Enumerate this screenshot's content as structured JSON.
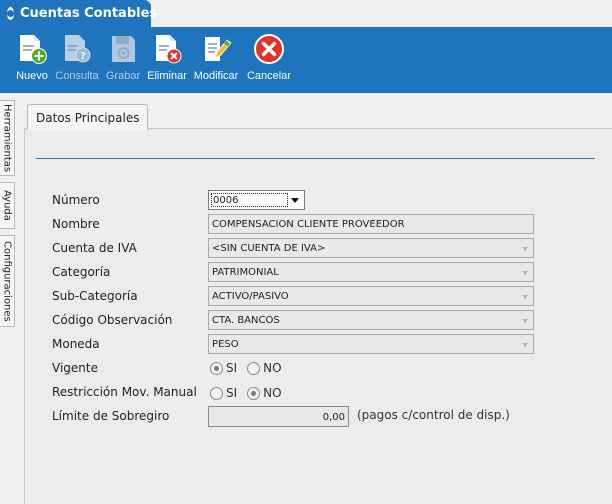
{
  "window": {
    "title": "Cuentas Contables"
  },
  "toolbar": {
    "buttons": [
      {
        "label": "Nuevo",
        "icon": "new-document-plus-icon",
        "enabled": true
      },
      {
        "label": "Consulta",
        "icon": "document-question-icon",
        "enabled": false
      },
      {
        "label": "Grabar",
        "icon": "save-disk-icon",
        "enabled": false
      },
      {
        "label": "Eliminar",
        "icon": "delete-document-icon",
        "enabled": true
      },
      {
        "label": "Modificar",
        "icon": "edit-pencil-icon",
        "enabled": true
      },
      {
        "label": "Cancelar",
        "icon": "cancel-x-icon",
        "enabled": true
      }
    ]
  },
  "side_tabs": [
    "Herramientas",
    "Ayuda",
    "Configuraciones"
  ],
  "panel": {
    "tab": "Datos Principales"
  },
  "form": {
    "numero": {
      "label": "Número",
      "value": "0006"
    },
    "nombre": {
      "label": "Nombre",
      "value": "COMPENSACION CLIENTE PROVEEDOR"
    },
    "cuenta_iva": {
      "label": "Cuenta de IVA",
      "value": "<SIN CUENTA DE IVA>"
    },
    "categoria": {
      "label": "Categoría",
      "value": "PATRIMONIAL"
    },
    "sub_categoria": {
      "label": "Sub-Categoría",
      "value": "ACTIVO/PASIVO"
    },
    "codigo_observacion": {
      "label": "Código Observación",
      "value": "CTA. BANCOS"
    },
    "moneda": {
      "label": "Moneda",
      "value": "PESO"
    },
    "vigente": {
      "label": "Vigente",
      "options": [
        "SI",
        "NO"
      ],
      "selected": "SI"
    },
    "restriccion": {
      "label": "Restricción Mov. Manual",
      "options": [
        "SI",
        "NO"
      ],
      "selected": "NO"
    },
    "limite": {
      "label": "Límite de Sobregiro",
      "value": "0,00",
      "note": "(pagos c/control de disp.)"
    }
  },
  "colors": {
    "accent": "#1e74bd",
    "panel_line": "#2e74b5",
    "cancel_red": "#e2332a"
  }
}
